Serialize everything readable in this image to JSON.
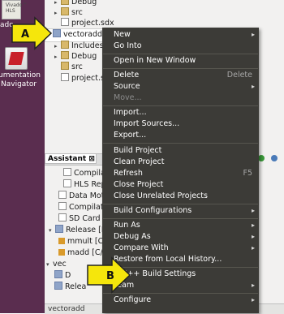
{
  "desktop": {
    "top_icon_label": "Vivado™ HLS",
    "partial_label": "ado",
    "docnav_label_line1": "umentation",
    "docnav_label_line2": "Navigator"
  },
  "explorer": {
    "rows": [
      {
        "label": "Debug",
        "icon": "folder",
        "arrow": "▸"
      },
      {
        "label": "src",
        "icon": "folder",
        "arrow": "▸"
      },
      {
        "label": "project.sdx",
        "icon": "file",
        "arrow": ""
      },
      {
        "label": "vectoradd",
        "icon": "project",
        "arrow": "▾"
      },
      {
        "label": "Includes",
        "icon": "folder",
        "arrow": "▸"
      },
      {
        "label": "Debug",
        "icon": "folder",
        "arrow": "▸"
      },
      {
        "label": "src",
        "icon": "folder",
        "arrow": ""
      },
      {
        "label": "project.sdx",
        "icon": "file",
        "arrow": ""
      }
    ]
  },
  "assistant": {
    "tab_label": "Assistant ⊠",
    "rows": [
      {
        "label": "Compila"
      },
      {
        "label": "HLS Rep"
      },
      {
        "label": "Data Moti"
      },
      {
        "label": "Compilati"
      },
      {
        "label": "SD Card Im"
      },
      {
        "label": "Release [Ha"
      },
      {
        "label": "mmult [C/"
      },
      {
        "label": "madd [C/C"
      },
      {
        "label": "vec"
      },
      {
        "label": "D"
      },
      {
        "label": "Relea"
      }
    ]
  },
  "statusbar": {
    "text": "vectoradd"
  },
  "context_menu": {
    "items": [
      {
        "label": "New",
        "accel": "",
        "submenu": true,
        "disabled": false
      },
      {
        "label": "Go Into",
        "accel": "",
        "submenu": false,
        "disabled": false
      },
      {
        "label": "Open in New Window",
        "accel": "",
        "submenu": false,
        "disabled": false
      },
      {
        "label": "Delete",
        "accel": "Delete",
        "submenu": false,
        "disabled": false
      },
      {
        "label": "Source",
        "accel": "",
        "submenu": true,
        "disabled": false
      },
      {
        "label": "Move...",
        "accel": "",
        "submenu": false,
        "disabled": true
      },
      {
        "label": "Import...",
        "accel": "",
        "submenu": false,
        "disabled": false
      },
      {
        "label": "Import Sources...",
        "accel": "",
        "submenu": false,
        "disabled": false
      },
      {
        "label": "Export...",
        "accel": "",
        "submenu": false,
        "disabled": false
      },
      {
        "label": "Build Project",
        "accel": "",
        "submenu": false,
        "disabled": false
      },
      {
        "label": "Clean Project",
        "accel": "",
        "submenu": false,
        "disabled": false
      },
      {
        "label": "Refresh",
        "accel": "F5",
        "submenu": false,
        "disabled": false
      },
      {
        "label": "Close Project",
        "accel": "",
        "submenu": false,
        "disabled": false
      },
      {
        "label": "Close Unrelated Projects",
        "accel": "",
        "submenu": false,
        "disabled": false
      },
      {
        "label": "Build Configurations",
        "accel": "",
        "submenu": true,
        "disabled": false
      },
      {
        "label": "Run As",
        "accel": "",
        "submenu": true,
        "disabled": false
      },
      {
        "label": "Debug As",
        "accel": "",
        "submenu": true,
        "disabled": false
      },
      {
        "label": "Compare With",
        "accel": "",
        "submenu": true,
        "disabled": false
      },
      {
        "label": "Restore from Local History...",
        "accel": "",
        "submenu": false,
        "disabled": false
      },
      {
        "label": "C/C++ Build Settings",
        "accel": "",
        "submenu": false,
        "disabled": false
      },
      {
        "label": "Team",
        "accel": "",
        "submenu": true,
        "disabled": false
      },
      {
        "label": "Configure",
        "accel": "",
        "submenu": true,
        "disabled": false
      }
    ]
  },
  "callouts": {
    "a": "A",
    "b": "B"
  },
  "colors": {
    "callout_fill": "#f5e60c",
    "menu_bg": "#3c3b37",
    "desktop": "#5a2d4f"
  }
}
